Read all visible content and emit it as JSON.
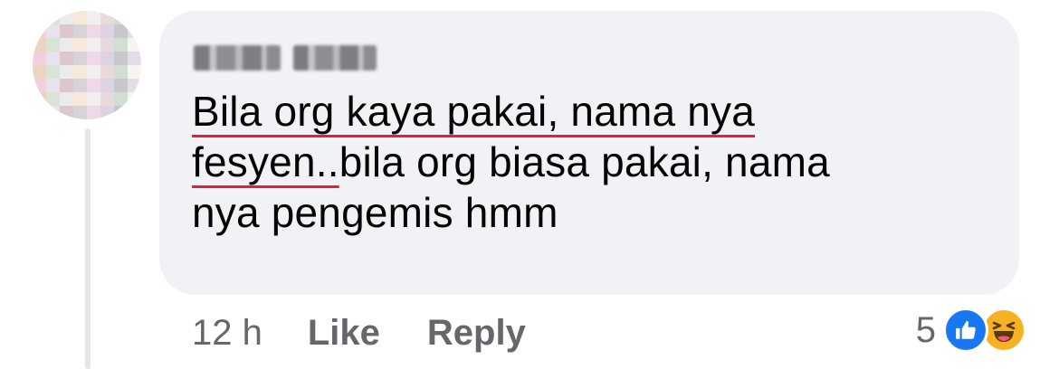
{
  "comment": {
    "author_name": "",
    "text_lines": [
      {
        "spell": "Bila org kaya pakai, nama nya",
        "rest": ""
      },
      {
        "spell": "fesyen..",
        "rest": "bila org biasa pakai, nama"
      },
      {
        "spell": "",
        "rest": "nya pengemis hmm"
      }
    ]
  },
  "actions": {
    "time": "12 h",
    "like_label": "Like",
    "reply_label": "Reply"
  },
  "reactions": {
    "count": "5",
    "icons": [
      "like-icon",
      "haha-icon"
    ]
  },
  "colors": {
    "bubble": "#f0f2f5",
    "text": "#050505",
    "secondary_text": "#65676b",
    "spellcheck_underline": "#e41e3f",
    "like_blue": "#1877f2",
    "haha_yellow": "#f7b125"
  }
}
